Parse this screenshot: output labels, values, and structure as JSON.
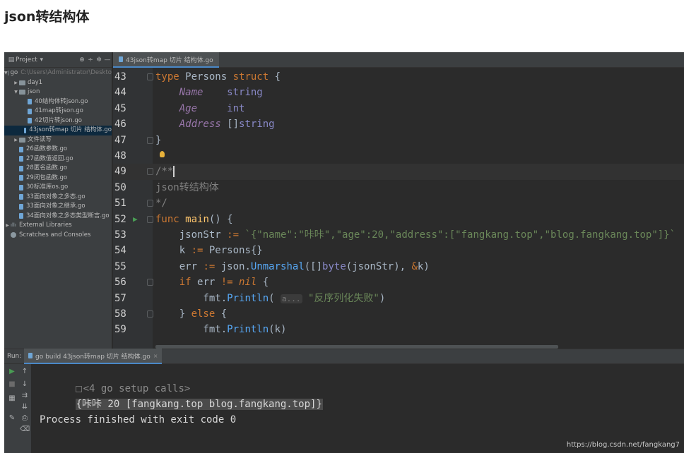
{
  "article": {
    "title": "json转结构体"
  },
  "project_panel": {
    "header_label": "Project",
    "tree": [
      {
        "label": "go",
        "sub": "C:\\Users\\Administrator\\Deskto",
        "type": "folder",
        "depth": 0,
        "expanded": true
      },
      {
        "label": "day1",
        "type": "folder",
        "depth": 1,
        "expanded": false
      },
      {
        "label": "json",
        "type": "folder",
        "depth": 1,
        "expanded": true
      },
      {
        "label": "40结构体转json.go",
        "type": "file",
        "depth": 2
      },
      {
        "label": "41map转json.go",
        "type": "file",
        "depth": 2
      },
      {
        "label": "42切片转json.go",
        "type": "file",
        "depth": 2
      },
      {
        "label": "43json转map 切片 结构体.go",
        "type": "file",
        "depth": 2,
        "selected": true
      },
      {
        "label": "文件读写",
        "type": "folder",
        "depth": 1,
        "expanded": false
      },
      {
        "label": "26函数参数.go",
        "type": "file",
        "depth": 1
      },
      {
        "label": "27函数值返回.go",
        "type": "file",
        "depth": 1
      },
      {
        "label": "28匿名函数.go",
        "type": "file",
        "depth": 1
      },
      {
        "label": "29闭包函数.go",
        "type": "file",
        "depth": 1
      },
      {
        "label": "30标准库os.go",
        "type": "file",
        "depth": 1
      },
      {
        "label": "33面向对象之多态.go",
        "type": "file",
        "depth": 1
      },
      {
        "label": "33面向对象之继承.go",
        "type": "file",
        "depth": 1
      },
      {
        "label": "34面向对象之多态类型断言.go",
        "type": "file",
        "depth": 1
      },
      {
        "label": "External Libraries",
        "type": "lib",
        "depth": 0,
        "expanded": false
      },
      {
        "label": "Scratches and Consoles",
        "type": "scratch",
        "depth": 0
      }
    ]
  },
  "editor": {
    "tab_label": "43json转map 切片 结构体.go",
    "lines": [
      {
        "n": "43",
        "html_tokens": [
          [
            "kw",
            "type "
          ],
          [
            "",
            "Persons "
          ],
          [
            "kw",
            "struct "
          ],
          [
            "",
            "{"
          ]
        ]
      },
      {
        "n": "44",
        "html_tokens": [
          [
            "",
            "    "
          ],
          [
            "fld",
            "Name"
          ],
          [
            "",
            "    "
          ],
          [
            "ty",
            "string"
          ]
        ]
      },
      {
        "n": "45",
        "html_tokens": [
          [
            "",
            "    "
          ],
          [
            "fld",
            "Age"
          ],
          [
            "",
            "     "
          ],
          [
            "ty",
            "int"
          ]
        ]
      },
      {
        "n": "46",
        "html_tokens": [
          [
            "",
            "    "
          ],
          [
            "fld",
            "Address"
          ],
          [
            "",
            " []"
          ],
          [
            "ty",
            "string"
          ]
        ]
      },
      {
        "n": "47",
        "html_tokens": [
          [
            "",
            "}"
          ]
        ]
      },
      {
        "n": "48",
        "html_tokens": []
      },
      {
        "n": "49",
        "html_tokens": [
          [
            "cm",
            "/**"
          ]
        ]
      },
      {
        "n": "50",
        "html_tokens": [
          [
            "cm",
            "json转结构体"
          ]
        ]
      },
      {
        "n": "51",
        "html_tokens": [
          [
            "cm",
            "*/"
          ]
        ]
      },
      {
        "n": "52",
        "html_tokens": [
          [
            "kw",
            "func "
          ],
          [
            "fn",
            "main"
          ],
          [
            "",
            "() {"
          ]
        ]
      },
      {
        "n": "53",
        "html_tokens": [
          [
            "",
            "    jsonStr "
          ],
          [
            "kw",
            ":= "
          ],
          [
            "str",
            "`{\"name\":\"咔咔\",\"age\":20,\"address\":[\"fangkang.top\",\"blog.fangkang.top\"]}`"
          ]
        ]
      },
      {
        "n": "54",
        "html_tokens": [
          [
            "",
            "    k "
          ],
          [
            "kw",
            ":= "
          ],
          [
            "",
            "Persons{}"
          ]
        ]
      },
      {
        "n": "55",
        "html_tokens": [
          [
            "",
            "    err "
          ],
          [
            "kw",
            ":= "
          ],
          [
            "",
            "json."
          ],
          [
            "call",
            "Unmarshal"
          ],
          [
            "",
            "([]"
          ],
          [
            "ty",
            "byte"
          ],
          [
            "",
            "(jsonStr), "
          ],
          [
            "kw",
            "&"
          ],
          [
            "",
            "k)"
          ]
        ]
      },
      {
        "n": "56",
        "html_tokens": [
          [
            "",
            "    "
          ],
          [
            "kw",
            "if "
          ],
          [
            "",
            "err "
          ],
          [
            "kw",
            "!= "
          ],
          [
            "nil",
            "nil"
          ],
          [
            "",
            " {"
          ]
        ]
      },
      {
        "n": "57",
        "html_tokens": [
          [
            "",
            "        fmt."
          ],
          [
            "call",
            "Println"
          ],
          [
            "",
            "( "
          ],
          [
            "hint",
            "a..."
          ],
          [
            "",
            " "
          ],
          [
            "str",
            "\"反序列化失败\""
          ],
          [
            "",
            ")"
          ]
        ]
      },
      {
        "n": "58",
        "html_tokens": [
          [
            "",
            "    } "
          ],
          [
            "kw",
            "else "
          ],
          [
            "",
            "{"
          ]
        ]
      },
      {
        "n": "59",
        "html_tokens": [
          [
            "",
            "        fmt."
          ],
          [
            "call",
            "Println"
          ],
          [
            "",
            "(k)"
          ]
        ]
      }
    ]
  },
  "run_panel": {
    "label": "Run:",
    "tab_label": "go build 43json转map 切片 结构体.go",
    "setup_calls": "<4 go setup calls>",
    "output": "{咔咔 20 [fangkang.top blog.fangkang.top]}",
    "finish": "Process finished with exit code 0"
  },
  "watermark": "https://blog.csdn.net/fangkang7",
  "colors": {
    "keyword": "#cc7832",
    "string": "#6a8759",
    "comment": "#808080",
    "background": "#2b2b2b"
  }
}
